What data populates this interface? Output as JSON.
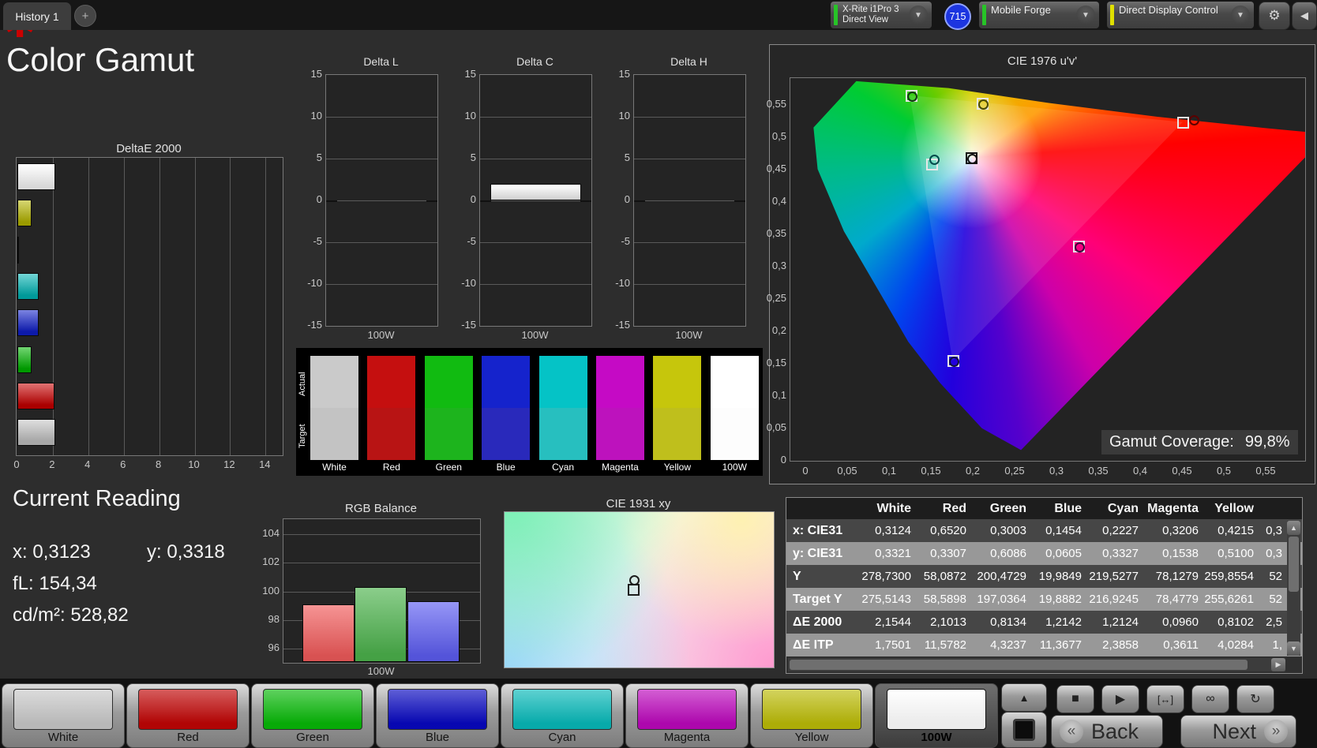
{
  "topbar": {
    "tab": "History 1",
    "add_tab": "+",
    "device": {
      "line1": "X-Rite i1Pro 3",
      "line2": "Direct View",
      "stripe": "#27c427"
    },
    "badge": "715",
    "source": {
      "label": "Mobile Forge",
      "stripe": "#27c427"
    },
    "control": {
      "label": "Direct Display Control",
      "stripe": "#e0e000"
    }
  },
  "page": {
    "title": "Color Gamut"
  },
  "chart_data": [
    {
      "type": "bar",
      "title": "DeltaE 2000",
      "orientation": "horizontal",
      "xticks": [
        0,
        2,
        4,
        6,
        8,
        10,
        12,
        14
      ],
      "xlim": [
        0,
        14
      ],
      "bars": [
        {
          "name": "White",
          "value": 2.15,
          "color": "#ffffff"
        },
        {
          "name": "Yellow",
          "value": 0.81,
          "color": "#b6b600"
        },
        {
          "name": "Magenta",
          "value": 0.1,
          "color": "#b400b4"
        },
        {
          "name": "Cyan",
          "value": 1.21,
          "color": "#00b4b4"
        },
        {
          "name": "Blue",
          "value": 1.21,
          "color": "#0f1ec8"
        },
        {
          "name": "Green",
          "value": 0.81,
          "color": "#00b400"
        },
        {
          "name": "Red",
          "value": 2.1,
          "color": "#c80000"
        },
        {
          "name": "100W",
          "value": 2.15,
          "color": "#c4c4c4"
        }
      ]
    },
    {
      "type": "bar",
      "group_title": "Delta charts",
      "yticks": [
        15,
        10,
        5,
        0,
        -5,
        -10,
        -15
      ],
      "ylim": [
        -15,
        15
      ],
      "xlabel": "100W",
      "panels": [
        {
          "title": "Delta L",
          "value": null
        },
        {
          "title": "Delta C",
          "value": 2.0
        },
        {
          "title": "Delta H",
          "value": null
        }
      ]
    },
    {
      "type": "bar",
      "title": "RGB Balance",
      "yticks": [
        104,
        102,
        100,
        98,
        96
      ],
      "ylim": [
        95,
        105
      ],
      "xlabel": "100W",
      "bars": [
        {
          "name": "Red",
          "value": 99.1,
          "color": "#f15b5b"
        },
        {
          "name": "Green",
          "value": 100.3,
          "color": "#4db34d"
        },
        {
          "name": "Blue",
          "value": 99.3,
          "color": "#5e5ef2"
        }
      ]
    },
    {
      "type": "scatter",
      "title": "CIE 1976 u'v'",
      "xticks": [
        "0",
        "0,05",
        "0,1",
        "0,15",
        "0,2",
        "0,25",
        "0,3",
        "0,35",
        "0,4",
        "0,45",
        "0,5",
        "0,55"
      ],
      "yticks": [
        "0,55",
        "0,5",
        "0,45",
        "0,4",
        "0,35",
        "0,3",
        "0,25",
        "0,2",
        "0,15",
        "0,1",
        "0,05",
        "0"
      ],
      "xlim": [
        0,
        0.55
      ],
      "ylim": [
        0,
        0.55
      ],
      "coverage_label": "Gamut Coverage:",
      "coverage_value": "99,8%",
      "points": [
        {
          "name": "green",
          "u": 0.125,
          "v": 0.565,
          "box": "#e8e8e8",
          "dot": "#123a12",
          "dx": 0,
          "dy": 0
        },
        {
          "name": "yellow",
          "u": 0.21,
          "v": 0.552,
          "box": "#e8e8e8",
          "dot": "#4a4a00",
          "dx": 0,
          "dy": 0
        },
        {
          "name": "red",
          "u": 0.45,
          "v": 0.523,
          "box": "#e8e8e8",
          "dot": "#5a0000",
          "dx": 13,
          "dy": -4
        },
        {
          "name": "white",
          "u": 0.197,
          "v": 0.468,
          "box": "#111111",
          "dot": "#111111",
          "dx": 0,
          "dy": 0
        },
        {
          "name": "cyan",
          "u": 0.15,
          "v": 0.458,
          "box": "#e8e8e8",
          "dot": "#004a4a",
          "dx": 2,
          "dy": -7
        },
        {
          "name": "magenta",
          "u": 0.325,
          "v": 0.332,
          "box": "#e8e8e8",
          "dot": "#3a003a",
          "dx": 0,
          "dy": 0
        },
        {
          "name": "blue",
          "u": 0.175,
          "v": 0.155,
          "box": "#e8e8e8",
          "dot": "#101040",
          "dx": 0,
          "dy": 0
        }
      ]
    },
    {
      "type": "scatter",
      "title": "CIE 1931 xy",
      "marker": {
        "x_pct": 48,
        "y_pct": 46
      }
    }
  ],
  "swatches": {
    "row_labels": [
      "Actual",
      "Target"
    ],
    "columns": [
      {
        "name": "White",
        "actual": "#cacaca",
        "target": "#c3c3c3"
      },
      {
        "name": "Red",
        "actual": "#c50f0f",
        "target": "#b81414"
      },
      {
        "name": "Green",
        "actual": "#11bb11",
        "target": "#1db41d"
      },
      {
        "name": "Blue",
        "actual": "#1523cc",
        "target": "#2929bb"
      },
      {
        "name": "Cyan",
        "actual": "#05c3c6",
        "target": "#27bfbf"
      },
      {
        "name": "Magenta",
        "actual": "#c50ac5",
        "target": "#bd12bd"
      },
      {
        "name": "Yellow",
        "actual": "#c6c60c",
        "target": "#bfbf1c"
      },
      {
        "name": "100W",
        "actual": "#ffffff",
        "target": "#fdfdfd"
      }
    ]
  },
  "current_reading": {
    "title": "Current Reading",
    "x_label": "x:",
    "x_value": "0,3123",
    "y_label": "y:",
    "y_value": "0,3318",
    "fl_label": "fL:",
    "fl_value": "154,34",
    "cd_label": "cd/m²:",
    "cd_value": "528,82"
  },
  "table": {
    "columns": [
      "White",
      "Red",
      "Green",
      "Blue",
      "Cyan",
      "Magenta",
      "Yellow"
    ],
    "rows": [
      {
        "label": "x: CIE31",
        "values": [
          "0,3124",
          "0,6520",
          "0,3003",
          "0,1454",
          "0,2227",
          "0,3206",
          "0,4215"
        ],
        "partial": "0,3"
      },
      {
        "label": "y: CIE31",
        "values": [
          "0,3321",
          "0,3307",
          "0,6086",
          "0,0605",
          "0,3327",
          "0,1538",
          "0,5100"
        ],
        "partial": "0,3"
      },
      {
        "label": "Y",
        "values": [
          "278,7300",
          "58,0872",
          "200,4729",
          "19,9849",
          "219,5277",
          "78,1279",
          "259,8554"
        ],
        "partial": "52"
      },
      {
        "label": "Target Y",
        "values": [
          "275,5143",
          "58,5898",
          "197,0364",
          "19,8882",
          "216,9245",
          "78,4779",
          "255,6261"
        ],
        "partial": "52"
      },
      {
        "label": "ΔE 2000",
        "values": [
          "2,1544",
          "2,1013",
          "0,8134",
          "1,2142",
          "1,2124",
          "0,0960",
          "0,8102"
        ],
        "partial": "2,5"
      },
      {
        "label": "ΔE ITP",
        "values": [
          "1,7501",
          "11,5782",
          "4,3237",
          "11,3677",
          "2,3858",
          "0,3611",
          "4,0284"
        ],
        "partial": "1,"
      }
    ]
  },
  "bottom": {
    "patches": [
      {
        "label": "White",
        "color": "#c8c8c8",
        "selected": false
      },
      {
        "label": "Red",
        "color": "#c00505",
        "selected": false
      },
      {
        "label": "Green",
        "color": "#08b908",
        "selected": false
      },
      {
        "label": "Blue",
        "color": "#0808c0",
        "selected": false
      },
      {
        "label": "Cyan",
        "color": "#08b9b9",
        "selected": false
      },
      {
        "label": "Magenta",
        "color": "#bc08bc",
        "selected": false
      },
      {
        "label": "Yellow",
        "color": "#bcbc08",
        "selected": false
      },
      {
        "label": "100W",
        "color": "#ffffff",
        "selected": true
      }
    ],
    "back_label": "Back",
    "next_label": "Next"
  }
}
